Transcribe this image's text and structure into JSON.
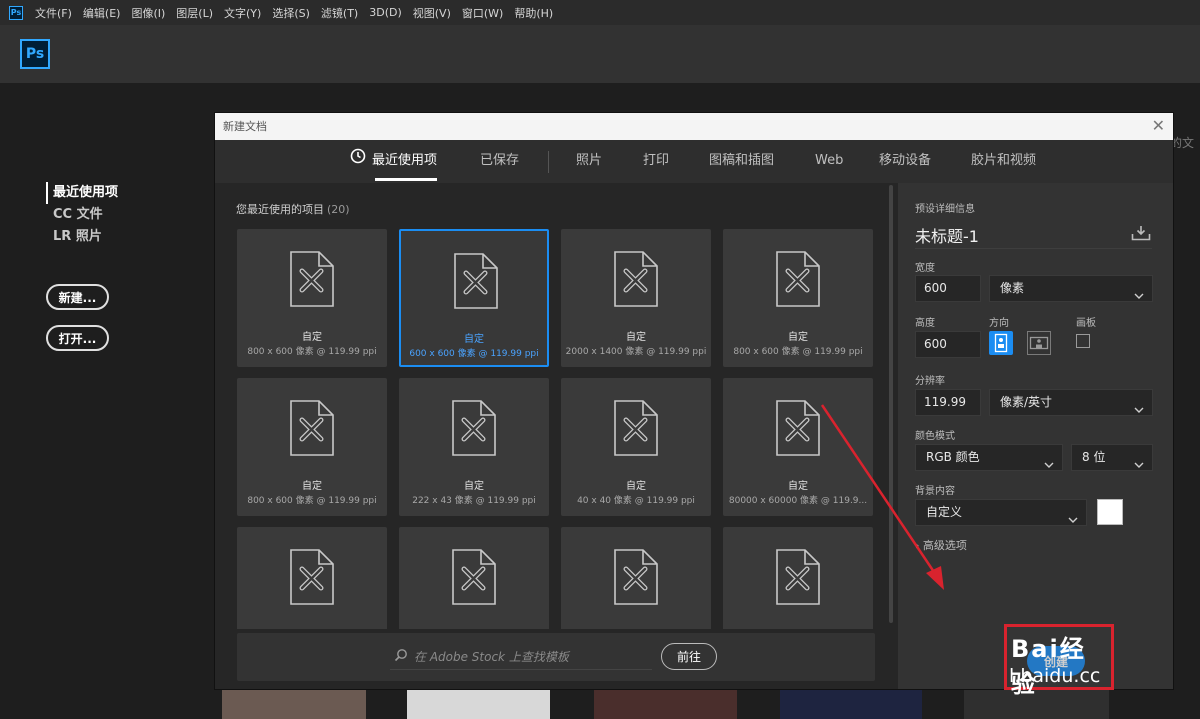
{
  "menubar": {
    "app_icon": "Ps",
    "items": [
      "文件(F)",
      "编辑(E)",
      "图像(I)",
      "图层(L)",
      "文字(Y)",
      "选择(S)",
      "滤镜(T)",
      "3D(D)",
      "视图(V)",
      "窗口(W)",
      "帮助(H)"
    ]
  },
  "home": {
    "logo": "Ps",
    "nav": [
      "最近使用项",
      "CC 文件",
      "LR 照片"
    ],
    "new_button": "新建...",
    "open_button": "打开...",
    "bg_text": "的文"
  },
  "dialog": {
    "title": "新建文档",
    "tabs": [
      "最近使用项",
      "已保存",
      "照片",
      "打印",
      "图稿和插图",
      "Web",
      "移动设备",
      "胶片和视频"
    ],
    "active_tab": "最近使用项",
    "recent_heading": "您最近使用的项目",
    "recent_count": "(20)",
    "presets": [
      {
        "name": "自定",
        "dims": "800 x 600 像素 @ 119.99 ppi"
      },
      {
        "name": "自定",
        "dims": "600 x 600 像素 @ 119.99 ppi",
        "selected": true
      },
      {
        "name": "自定",
        "dims": "2000 x 1400 像素 @ 119.99 ppi"
      },
      {
        "name": "自定",
        "dims": "800 x 600 像素 @ 119.99 ppi"
      },
      {
        "name": "自定",
        "dims": "800 x 600 像素 @ 119.99 ppi"
      },
      {
        "name": "自定",
        "dims": "222 x 43 像素 @ 119.99 ppi"
      },
      {
        "name": "自定",
        "dims": "40 x 40 像素 @ 119.99 ppi"
      },
      {
        "name": "自定",
        "dims": "80000 x 60000 像素 @ 119.9..."
      },
      {
        "name": "",
        "dims": ""
      },
      {
        "name": "",
        "dims": ""
      },
      {
        "name": "",
        "dims": ""
      },
      {
        "name": "",
        "dims": ""
      }
    ],
    "stock": {
      "placeholder": "在 Adobe Stock 上查找模板",
      "go_button": "前往"
    },
    "details": {
      "heading": "预设详细信息",
      "doc_name": "未标题-1",
      "width_label": "宽度",
      "width_value": "600",
      "width_unit": "像素",
      "height_label": "高度",
      "height_value": "600",
      "orientation_label": "方向",
      "artboard_label": "画板",
      "resolution_label": "分辨率",
      "resolution_value": "119.99",
      "resolution_unit": "像素/英寸",
      "color_mode_label": "颜色模式",
      "color_mode": "RGB 颜色",
      "bit_depth": "8 位",
      "background_label": "背景内容",
      "background": "自定义",
      "background_color": "#ffffff",
      "advanced": "高级选项",
      "create_button": "创建"
    }
  },
  "watermark": {
    "top": "Bai经验",
    "bottom": "l.baidu.cc"
  },
  "colors": {
    "accent": "#1b8df2",
    "ps_blue": "#31a8ff",
    "annotation": "#d9232e"
  }
}
